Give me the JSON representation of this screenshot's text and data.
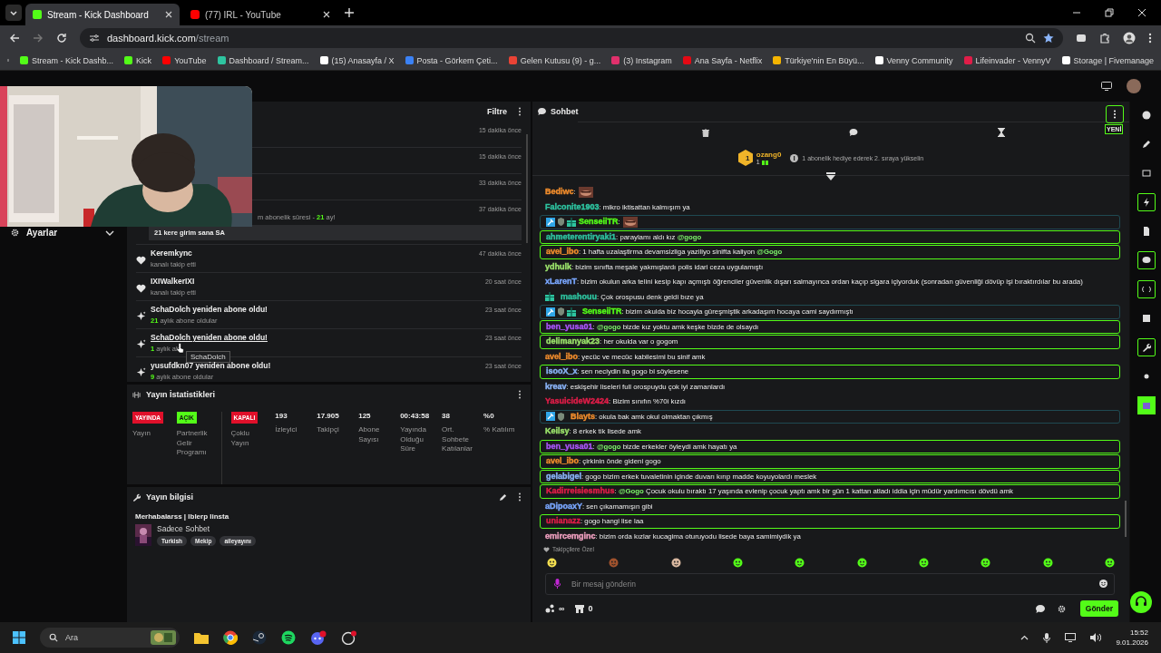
{
  "browser": {
    "tabs": [
      {
        "title": "Stream - Kick Dashboard",
        "selected": true
      },
      {
        "title": "(77) İRL - YouTube",
        "selected": false
      }
    ],
    "url": {
      "host": "dashboard.kick.com",
      "path": "/stream"
    },
    "bookmarks": [
      "Stream - Kick Dashb...",
      "Kick",
      "YouTube",
      "Dashboard / Stream...",
      "(15) Anasayfa / X",
      "Posta - Görkem Çeti...",
      "Gelen Kutusu (9) - g...",
      "(3) Instagram",
      "Ana Sayfa - Netflix",
      "Türkiye'nin En Büyü...",
      "Venny Community",
      "Lifeinvader - VennyV",
      "Storage | Fivemanage"
    ]
  },
  "sidebar": {
    "settings_label": "Ayarlar"
  },
  "activity": {
    "filter_label": "Filtre",
    "items": [
      {
        "kind": "hidden",
        "time": "15 dakika önce"
      },
      {
        "kind": "hidden",
        "time": "15 dakika önce"
      },
      {
        "kind": "hidden",
        "time": "33 dakika önce"
      },
      {
        "kind": "hidden",
        "time": "37 dakika önce",
        "sub": [
          {
            "kind": "text",
            "text": "m abonelik süresi - "
          },
          {
            "kind": "count",
            "text": "21"
          },
          {
            "kind": "text",
            "text": " ay!"
          }
        ],
        "message": "21 kere girim sana SA"
      },
      {
        "kind": "follow",
        "title": "Keremkync",
        "hovered": false,
        "time": "47 dakika önce",
        "sub": [
          {
            "kind": "text",
            "text": "kanalı takip etti"
          }
        ]
      },
      {
        "kind": "follow",
        "title": "IXIWalkerIXI",
        "hovered": false,
        "time": "20 saat önce",
        "sub": [
          {
            "kind": "text",
            "text": "kanalı takip etti"
          }
        ]
      },
      {
        "kind": "resub",
        "title": "SchaDolch yeniden abone oldu!",
        "hovered": false,
        "time": "23 saat önce",
        "sub": [
          {
            "kind": "count",
            "text": "21"
          },
          {
            "kind": "text",
            "text": " aylık abone oldular"
          }
        ]
      },
      {
        "kind": "resub",
        "title": "SchaDolch yeniden abone oldu!",
        "hovered": true,
        "tooltip": "SchaDolch",
        "time": "23 saat önce",
        "sub": [
          {
            "kind": "count",
            "text": "1"
          },
          {
            "kind": "text",
            "text": " aylık ab"
          }
        ]
      },
      {
        "kind": "resub",
        "title": "yusufdkn07 yeniden abone oldu!",
        "hovered": false,
        "time": "23 saat önce",
        "sub": [
          {
            "kind": "count",
            "text": "9"
          },
          {
            "kind": "text",
            "text": " aylık abone oldular"
          }
        ]
      }
    ]
  },
  "stats": {
    "title": "Yayın İstatistikleri",
    "statuses": [
      {
        "badge": "YAYINDA",
        "label": "Yayın",
        "color": "#e0102a"
      },
      {
        "badge": "AÇIK",
        "label": "Partnerlik Gelir Programı",
        "color": "#53fc18"
      },
      {
        "badge": "KAPALI",
        "label": "Çoklu Yayın",
        "color": "#e0102a"
      }
    ],
    "metrics": [
      {
        "value": "193",
        "label": "İzleyici"
      },
      {
        "value": "17.905",
        "label": "Takipçi"
      },
      {
        "value": "125",
        "label": "Abone Sayısı"
      },
      {
        "value": "00:43:58",
        "label": "Yayında Olduğu Süre"
      },
      {
        "value": "38",
        "label": "Ort. Sohbete Katılanlar"
      },
      {
        "value": "%0",
        "label": "% Katılım"
      }
    ]
  },
  "stream_info": {
    "title": "Yayın bilgisi",
    "stream_title": "Merhabalarss | Iblerp Iinsta",
    "category": "Sadece Sohbet",
    "tags": [
      "Turkish",
      "Mekip",
      "aileyayını"
    ]
  },
  "chat": {
    "title": "Sohbet",
    "new_label": "YENİ",
    "leader": {
      "rank": "1",
      "name": "ozang0",
      "count": "1",
      "hint": "1 abonelik hediye ederek 2. sıraya yükselin"
    },
    "messages": [
      {
        "user": "Bediwc",
        "color": "#f08c2c",
        "highlighted": false,
        "parts": [
          {
            "kind": "text",
            "text": ":"
          },
          {
            "kind": "emote"
          }
        ]
      },
      {
        "user": "Falconite1903",
        "color": "#2ec4a0",
        "highlighted": false,
        "parts": [
          {
            "kind": "text",
            "text": ": mikro iktisattan kalmışım ya"
          }
        ]
      },
      {
        "user": "SenseiiTR",
        "color": "#53fc18",
        "highlighted": false,
        "badges": [
          {
            "kind": "mod"
          },
          {
            "kind": "shield"
          },
          {
            "kind": "gift"
          }
        ],
        "parts": [
          {
            "kind": "text",
            "text": ":"
          },
          {
            "kind": "emote"
          }
        ]
      },
      {
        "user": "ahmeterentiryaki1",
        "color": "#2ec4a0",
        "highlighted": true,
        "parts": [
          {
            "kind": "text",
            "text": ": paraylamı aldı kız "
          },
          {
            "kind": "mention",
            "text": "@gogo"
          }
        ]
      },
      {
        "user": "avel_ibo",
        "color": "#f08c2c",
        "highlighted": true,
        "parts": [
          {
            "kind": "text",
            "text": ": 1 hafta uzalaştirma devamsizliga yaziliyo sinifta kaliyon "
          },
          {
            "kind": "mention",
            "text": "@Gogo"
          }
        ]
      },
      {
        "user": "ydhulk",
        "color": "#9be36b",
        "highlighted": false,
        "parts": [
          {
            "kind": "text",
            "text": ": bizim sınıfta meşale yakmışlardı polis idari ceza uygulamıştı"
          }
        ]
      },
      {
        "user": "xLarenT",
        "color": "#7aa7ff",
        "highlighted": false,
        "parts": [
          {
            "kind": "text",
            "text": ": bizim okulun arka telini kesip kapı açmıştı öğrenciler güvenlik dışarı salmayınca ordan kaçıp sigara içiyorduk (sonradan güvenliği dövüp işi bıraktırdılar bu arada)"
          }
        ]
      },
      {
        "user": "mashouu",
        "color": "#2ec4a0",
        "highlighted": false,
        "badges": [
          {
            "kind": "gift"
          }
        ],
        "parts": [
          {
            "kind": "text",
            "text": ": Çok orospusu denk geldi bıze ya"
          }
        ]
      },
      {
        "user": "SenseiiTR",
        "color": "#53fc18",
        "highlighted": false,
        "badges": [
          {
            "kind": "mod"
          },
          {
            "kind": "shield"
          },
          {
            "kind": "gift"
          }
        ],
        "parts": [
          {
            "kind": "text",
            "text": ": bizim okulda biz hocayla güreşmiştik arkadaşım hocaya cami saydırmıştı"
          }
        ]
      },
      {
        "user": "ben_yusa01",
        "color": "#a855f7",
        "highlighted": true,
        "parts": [
          {
            "kind": "text",
            "text": ": "
          },
          {
            "kind": "mention",
            "text": "@gogo"
          },
          {
            "kind": "text",
            "text": " bizde kız yoktu amk keşke bizde de olsaydı"
          }
        ]
      },
      {
        "user": "delimanyak23",
        "color": "#9be36b",
        "highlighted": true,
        "parts": [
          {
            "kind": "text",
            "text": ": her okulda var o gogom"
          }
        ]
      },
      {
        "user": "avel_ibo",
        "color": "#f08c2c",
        "highlighted": false,
        "parts": [
          {
            "kind": "text",
            "text": ": yecüc ve mecüc kabilesimi bu sinif amk"
          }
        ]
      },
      {
        "user": "isooX_x",
        "color": "#8ab4f8",
        "highlighted": true,
        "parts": [
          {
            "kind": "text",
            "text": ": sen neciydin ila gogo bi söylesene"
          }
        ]
      },
      {
        "user": "kreav",
        "color": "#8ab4f8",
        "highlighted": false,
        "parts": [
          {
            "kind": "text",
            "text": ": eskişehir liseleri full orospuydu çok iyi zamanlardı"
          }
        ]
      },
      {
        "user": "YasuicideW2424",
        "color": "#e11d48",
        "highlighted": false,
        "parts": [
          {
            "kind": "text",
            "text": ": Bizim sınıfın %70i kızdı"
          }
        ]
      },
      {
        "user": "Blayts",
        "color": "#f08c2c",
        "highlighted": false,
        "badges": [
          {
            "kind": "mod"
          },
          {
            "kind": "shield"
          }
        ],
        "parts": [
          {
            "kind": "text",
            "text": ": okula bak amk okul olmaktan çıkmış"
          }
        ]
      },
      {
        "user": "Keilsy",
        "color": "#9be36b",
        "highlighted": false,
        "parts": [
          {
            "kind": "text",
            "text": ": 8 erkek tik lisede amk"
          }
        ]
      },
      {
        "user": "ben_yusa01",
        "color": "#a855f7",
        "highlighted": true,
        "parts": [
          {
            "kind": "text",
            "text": ": "
          },
          {
            "kind": "mention",
            "text": "@gogo"
          },
          {
            "kind": "text",
            "text": " bizde erkekler öyleydi amk hayatı ya"
          }
        ]
      },
      {
        "user": "avel_ibo",
        "color": "#f08c2c",
        "highlighted": true,
        "parts": [
          {
            "kind": "text",
            "text": ": çirkinin önde gideni gogo"
          }
        ]
      },
      {
        "user": "gelabigel",
        "color": "#8ab4f8",
        "highlighted": true,
        "parts": [
          {
            "kind": "text",
            "text": ": gogo bizim erkek tuvaletinin içinde duvarı kırıp madde koyuyolardı meslek"
          }
        ]
      },
      {
        "user": "Kadirreisiesmhus",
        "color": "#e11d48",
        "highlighted": true,
        "parts": [
          {
            "kind": "text",
            "text": ": "
          },
          {
            "kind": "mention",
            "text": "@Gogo"
          },
          {
            "kind": "text",
            "text": " Çocuk okulu bıraktı 17 yaşında evlenip çocuk yaptı amk bir gün 1 kattan atladı iddia için müdür yardımcısı dövdü amk"
          }
        ]
      },
      {
        "user": "aDipoaxY",
        "color": "#7aa7ff",
        "highlighted": false,
        "parts": [
          {
            "kind": "text",
            "text": ": sen çıkamamışın gibi"
          }
        ]
      },
      {
        "user": "unianazz",
        "color": "#e11d48",
        "highlighted": true,
        "parts": [
          {
            "kind": "text",
            "text": ": gogo hangi lise laa"
          }
        ]
      },
      {
        "user": "emircemginc",
        "color": "#f0a0c0",
        "highlighted": false,
        "parts": [
          {
            "kind": "text",
            "text": ": bizim orda kızlar kucagima oturuyodu lisede baya samimiydik ya"
          }
        ]
      }
    ],
    "emote_section": "Takipçilere Özel",
    "input": {
      "placeholder": "Bir mesaj gönderin"
    },
    "points": "∞",
    "store_count": "0",
    "send_label": "Gönder"
  },
  "taskbar": {
    "search_placeholder": "Ara",
    "time": "15:52",
    "date": "9.01.2026"
  }
}
